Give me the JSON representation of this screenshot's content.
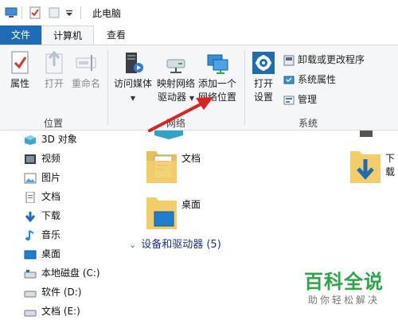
{
  "window": {
    "title": "此电脑"
  },
  "tabs": {
    "file": "文件",
    "computer": "计算机",
    "view": "查看"
  },
  "ribbon": {
    "location": {
      "label": "位置",
      "properties": "属性",
      "open": "打开",
      "rename": "重命名"
    },
    "network": {
      "label": "网络",
      "access_media": "访问媒体",
      "map_drive_line1": "映射网络",
      "map_drive_line2": "驱动器",
      "add_location_line1": "添加一个",
      "add_location_line2": "网络位置"
    },
    "system": {
      "label": "系统",
      "open_settings_line1": "打开",
      "open_settings_line2": "设置",
      "uninstall": "卸载或更改程序",
      "system_properties": "系统属性",
      "manage": "管理"
    }
  },
  "nav": {
    "items": [
      {
        "label": "3D 对象",
        "icon": "3d-objects-icon"
      },
      {
        "label": "视频",
        "icon": "videos-icon"
      },
      {
        "label": "图片",
        "icon": "pictures-icon"
      },
      {
        "label": "文档",
        "icon": "documents-icon"
      },
      {
        "label": "下载",
        "icon": "downloads-icon"
      },
      {
        "label": "音乐",
        "icon": "music-icon"
      },
      {
        "label": "桌面",
        "icon": "desktop-icon"
      },
      {
        "label": "本地磁盘 (C:)",
        "icon": "drive-icon"
      },
      {
        "label": "软件 (D:)",
        "icon": "drive-icon"
      },
      {
        "label": "文档 (E:)",
        "icon": "drive-icon"
      }
    ]
  },
  "content": {
    "folders": {
      "documents": "文档",
      "downloads": "下载",
      "desktop": "桌面"
    },
    "devices_header": "设备和驱动器 (5)"
  },
  "watermark": {
    "title": "百科全说",
    "subtitle": "助你轻松解决"
  },
  "colors": {
    "accent": "#1e6cb5",
    "annotation_arrow": "#e02020",
    "watermark": "#29a744"
  }
}
